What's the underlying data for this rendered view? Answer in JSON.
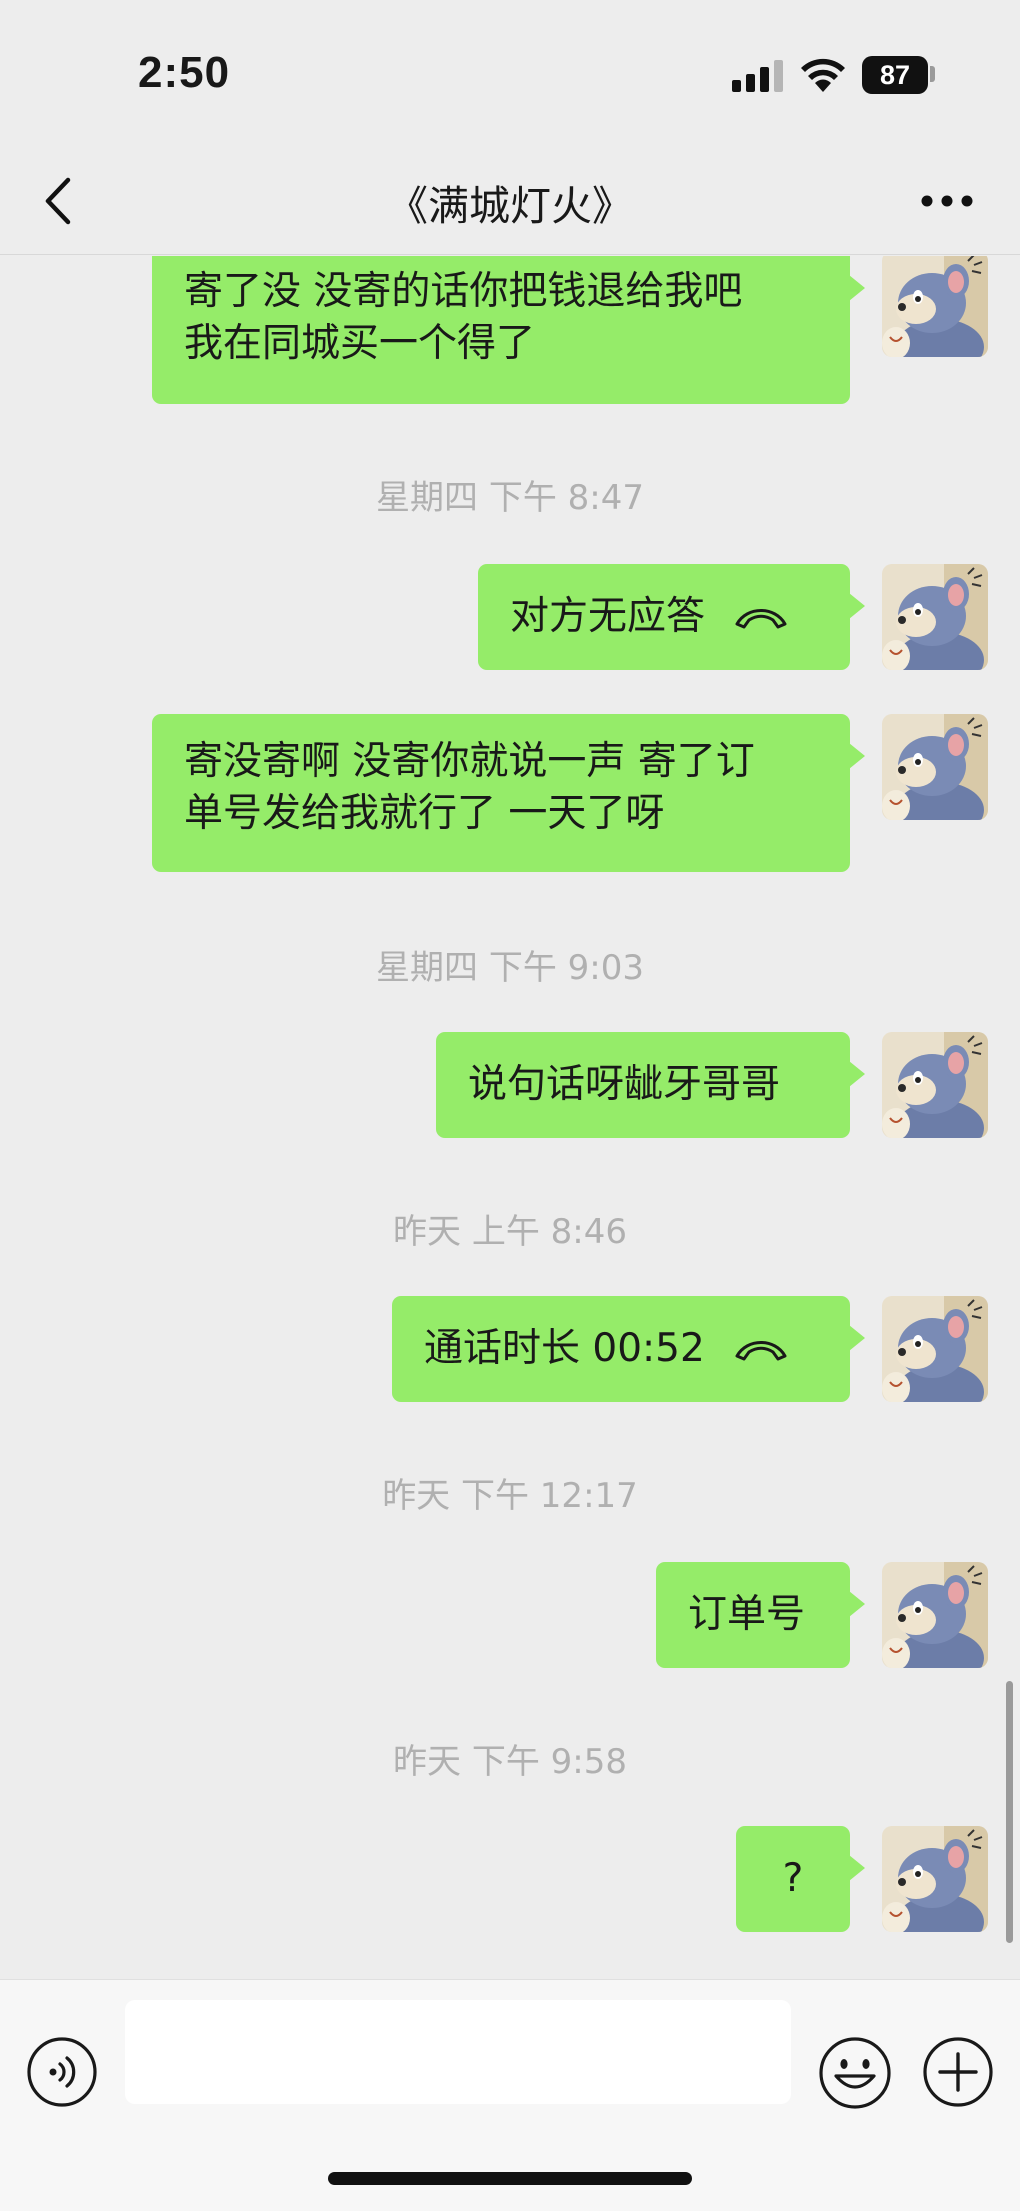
{
  "status_bar": {
    "time": "2:50",
    "battery": "87"
  },
  "header": {
    "title": "《满城灯火》"
  },
  "messages": [
    {
      "text": "寄了没 没寄的话你把钱退给我吧\n我在同城买一个得了"
    },
    {
      "timestamp": "星期四 下午 8:47"
    },
    {
      "text": "对方无应答",
      "icon": "call-icon"
    },
    {
      "text": "寄没寄啊 没寄你就说一声 寄了订\n单号发给我就行了 一天了呀"
    },
    {
      "timestamp": "星期四 下午 9:03"
    },
    {
      "text": "说句话呀龇牙哥哥"
    },
    {
      "timestamp": "昨天 上午 8:46"
    },
    {
      "text": "通话时长 00:52",
      "icon": "call-icon"
    },
    {
      "timestamp": "昨天 下午 12:17"
    },
    {
      "text": "订单号"
    },
    {
      "timestamp": "昨天 下午 9:58"
    },
    {
      "text": "?"
    }
  ],
  "input": {
    "value": "",
    "placeholder": ""
  },
  "colors": {
    "bubble_green": "#95ec69",
    "background": "#ededed",
    "timestamp_gray": "#b0b0b0"
  }
}
